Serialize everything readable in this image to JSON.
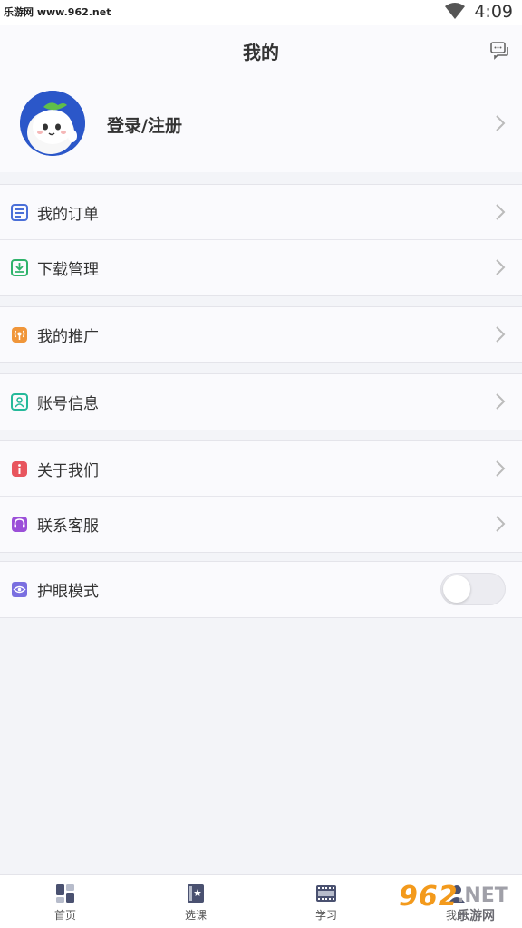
{
  "status_bar": {
    "carrier_text": "乐游网 www.962.net",
    "time": "4:09"
  },
  "header": {
    "title": "我的",
    "message_icon": "chat-bubbles-icon"
  },
  "profile": {
    "login_label": "登录/注册"
  },
  "menu_groups": [
    {
      "items": [
        {
          "label": "我的订单",
          "icon": "order-list-icon",
          "color": "#4a6fd8"
        },
        {
          "label": "下载管理",
          "icon": "download-icon",
          "color": "#2fb36b"
        }
      ]
    },
    {
      "items": [
        {
          "label": "我的推广",
          "icon": "broadcast-icon",
          "color": "#f0963a"
        }
      ]
    },
    {
      "items": [
        {
          "label": "账号信息",
          "icon": "user-card-icon",
          "color": "#25b99a"
        }
      ]
    },
    {
      "items": [
        {
          "label": "关于我们",
          "icon": "info-icon",
          "color": "#e8555e"
        },
        {
          "label": "联系客服",
          "icon": "headset-icon",
          "color": "#9b4fd8"
        }
      ]
    },
    {
      "items": [
        {
          "label": "护眼模式",
          "icon": "eye-icon",
          "color": "#7a6fe0",
          "toggle": false
        }
      ]
    }
  ],
  "tabbar": {
    "tabs": [
      {
        "label": "首页",
        "icon": "home-grid-icon"
      },
      {
        "label": "选课",
        "icon": "course-card-icon"
      },
      {
        "label": "学习",
        "icon": "film-icon"
      },
      {
        "label": "我的",
        "icon": "profile-icon"
      }
    ]
  },
  "watermark": {
    "num": "962",
    "net": ".NET",
    "cn": "乐游网"
  }
}
